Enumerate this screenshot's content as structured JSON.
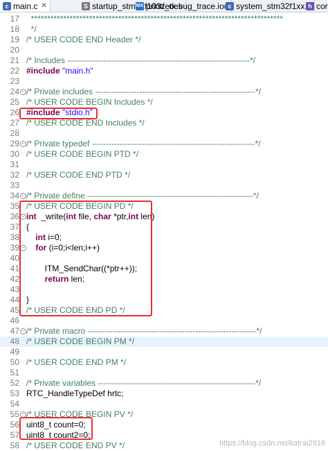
{
  "tabs": [
    {
      "icon": "c",
      "label": "main.c",
      "close": "✕",
      "active": true
    },
    {
      "icon": "s",
      "label": "startup_stm32f103zetx.s",
      "active": false
    },
    {
      "icon": "mx",
      "label": "printf_debug_trace.ioc",
      "active": false
    },
    {
      "icon": "c",
      "label": "system_stm32f1xx.c",
      "active": false
    },
    {
      "icon": "h",
      "label": "core",
      "active": false
    }
  ],
  "icon_text": {
    "c": "c",
    "s": "S",
    "mx": "MX",
    "h": "h"
  },
  "lines": [
    {
      "n": "17",
      "t": "  ******************************************************************************"
    },
    {
      "n": "18",
      "t": "  */"
    },
    {
      "n": "19",
      "t": "/* USER CODE END Header */"
    },
    {
      "n": "20",
      "t": ""
    },
    {
      "n": "21",
      "t": "/* Includes ------------------------------------------------------------------*/"
    },
    {
      "n": "22",
      "t": "#include \"main.h\""
    },
    {
      "n": "23",
      "t": ""
    },
    {
      "n": "24",
      "t": "/* Private includes ----------------------------------------------------------*/",
      "fold": true
    },
    {
      "n": "25",
      "t": "/* USER CODE BEGIN Includes */"
    },
    {
      "n": "26",
      "t": "#include \"stdio.h\""
    },
    {
      "n": "27",
      "t": "/* USER CODE END Includes */"
    },
    {
      "n": "28",
      "t": ""
    },
    {
      "n": "29",
      "t": "/* Private typedef -----------------------------------------------------------*/",
      "fold": true
    },
    {
      "n": "30",
      "t": "/* USER CODE BEGIN PTD */"
    },
    {
      "n": "31",
      "t": ""
    },
    {
      "n": "32",
      "t": "/* USER CODE END PTD */"
    },
    {
      "n": "33",
      "t": ""
    },
    {
      "n": "34",
      "t": "/* Private define ------------------------------------------------------------*/",
      "fold": true
    },
    {
      "n": "35",
      "t": "/* USER CODE BEGIN PD */"
    },
    {
      "n": "36",
      "t": "int  _write(int file, char *ptr,int len)",
      "fold": true
    },
    {
      "n": "37",
      "t": "{"
    },
    {
      "n": "38",
      "t": "    int i=0;"
    },
    {
      "n": "39",
      "t": "    for (i=0;i<len;i++)",
      "fold": true
    },
    {
      "n": "40",
      "t": ""
    },
    {
      "n": "41",
      "t": "        ITM_SendChar((*ptr++));"
    },
    {
      "n": "42",
      "t": "        return len;"
    },
    {
      "n": "43",
      "t": ""
    },
    {
      "n": "44",
      "t": "}"
    },
    {
      "n": "45",
      "t": "/* USER CODE END PD */"
    },
    {
      "n": "46",
      "t": ""
    },
    {
      "n": "47",
      "t": "/* Private macro -------------------------------------------------------------*/",
      "fold": true
    },
    {
      "n": "48",
      "t": "/* USER CODE BEGIN PM */",
      "highlight": true
    },
    {
      "n": "49",
      "t": ""
    },
    {
      "n": "50",
      "t": "/* USER CODE END PM */"
    },
    {
      "n": "51",
      "t": ""
    },
    {
      "n": "52",
      "t": "/* Private variables ---------------------------------------------------------*/"
    },
    {
      "n": "53",
      "t": "RTC_HandleTypeDef hrtc;"
    },
    {
      "n": "54",
      "t": ""
    },
    {
      "n": "55",
      "t": "/* USER CODE BEGIN PV */",
      "fold": true
    },
    {
      "n": "56",
      "t": "uint8_t count=0;"
    },
    {
      "n": "57",
      "t": "uint8_t count2=0;"
    },
    {
      "n": "58",
      "t": "/* USER CODE END PV */"
    }
  ],
  "watermark": "https://blog.csdn.net/katrai2919",
  "fold_glyph": "−",
  "colors": {
    "comment": "#3f7f5f",
    "keyword": "#7f0055",
    "string": "#2a00ff",
    "highlight_box": "#e53030"
  }
}
